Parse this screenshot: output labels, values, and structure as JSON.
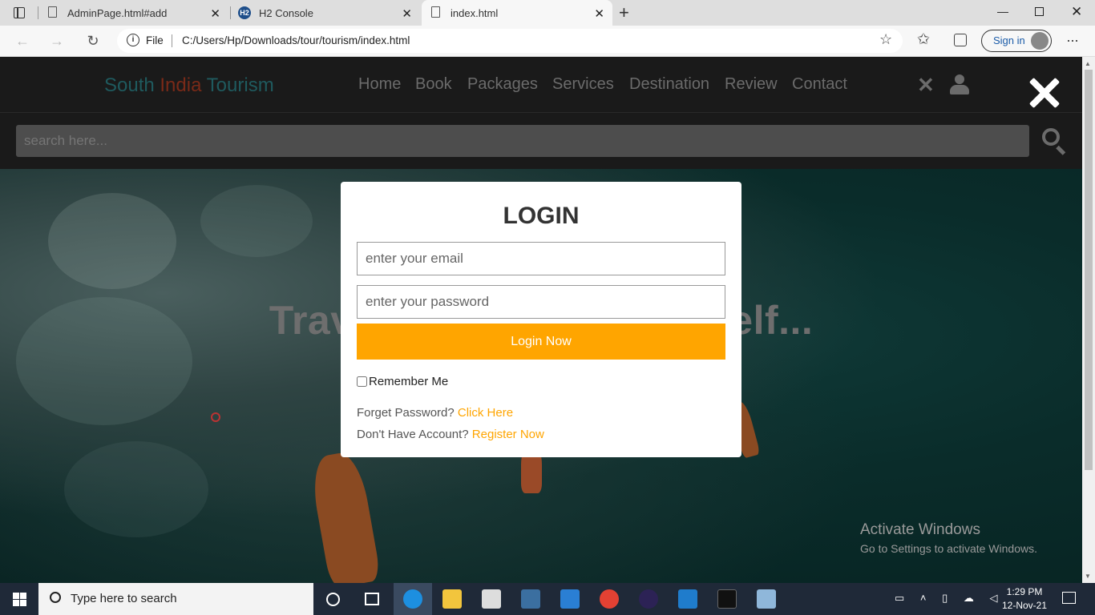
{
  "browser": {
    "tabs": [
      {
        "title": "AdminPage.html#add"
      },
      {
        "title": "H2 Console"
      },
      {
        "title": "index.html"
      }
    ],
    "address_prefix": "File",
    "url": "C:/Users/Hp/Downloads/tour/tourism/index.html",
    "signin_label": "Sign in"
  },
  "site": {
    "logo_part1": "South ",
    "logo_part2": "India ",
    "logo_part3": "Tourism",
    "nav": [
      "Home",
      "Book",
      "Packages",
      "Services",
      "Destination",
      "Review",
      "Contact"
    ],
    "search_placeholder": "search here...",
    "hero_text": "Travel To Explore Yourself..."
  },
  "login": {
    "title": "LOGIN",
    "email_placeholder": "enter your email",
    "password_placeholder": "enter your password",
    "button_label": "Login Now",
    "remember_label": "Remember Me",
    "forgot_text": "Forget Password? ",
    "forgot_link": "Click Here",
    "noacct_text": "Don't Have Account? ",
    "register_link": "Register Now"
  },
  "watermark": {
    "line1": "Activate Windows",
    "line2": "Go to Settings to activate Windows."
  },
  "taskbar": {
    "search_placeholder": "Type here to search",
    "time": "1:29 PM",
    "date": "12-Nov-21"
  },
  "colors": {
    "accent": "#ffa500",
    "logo_teal": "#1f5a5e",
    "logo_red": "#7a2a18"
  }
}
